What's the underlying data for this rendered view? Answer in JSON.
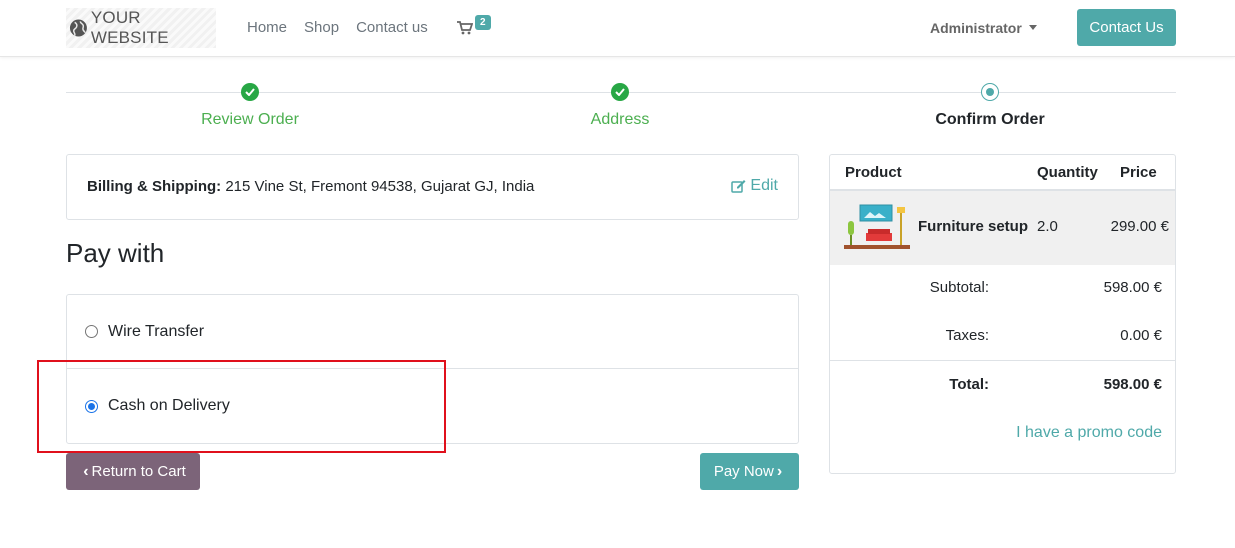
{
  "header": {
    "logo_text": "YOUR WEBSITE",
    "nav": [
      "Home",
      "Shop",
      "Contact us"
    ],
    "cart_count": "2",
    "user": "Administrator",
    "contact_button": "Contact Us"
  },
  "progress": {
    "steps": [
      {
        "label": "Review Order",
        "state": "done"
      },
      {
        "label": "Address",
        "state": "done"
      },
      {
        "label": "Confirm Order",
        "state": "current"
      }
    ]
  },
  "billing": {
    "label": "Billing & Shipping:",
    "address": "215 Vine St, Fremont 94538, Gujarat GJ, India",
    "edit": "Edit"
  },
  "payment": {
    "heading": "Pay with",
    "options": [
      {
        "label": "Wire Transfer",
        "selected": false
      },
      {
        "label": "Cash on Delivery",
        "selected": true
      }
    ],
    "return_button": "Return to Cart",
    "pay_button": "Pay Now"
  },
  "summary": {
    "columns": {
      "product": "Product",
      "quantity": "Quantity",
      "price": "Price"
    },
    "items": [
      {
        "name": "Furniture setup",
        "quantity": "2.0",
        "price": "299.00 €"
      }
    ],
    "subtotal_label": "Subtotal:",
    "subtotal": "598.00 €",
    "taxes_label": "Taxes:",
    "taxes": "0.00 €",
    "total_label": "Total:",
    "total": "598.00 €",
    "promo": "I have a promo code"
  },
  "colors": {
    "accent": "#4fa9a9",
    "success": "#28a745",
    "return_button": "#7c6479",
    "highlight": "#e0101c"
  }
}
